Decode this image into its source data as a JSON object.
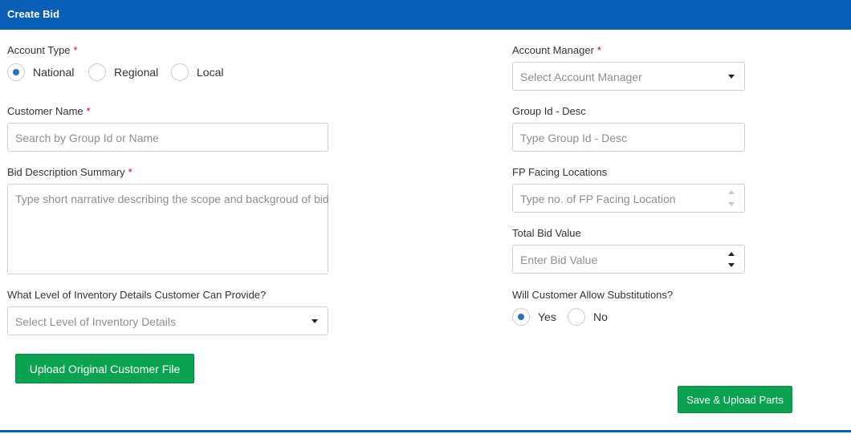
{
  "colors": {
    "brand": "#0a5fb8",
    "accent": "#2d6fc2",
    "button": "#0aa350",
    "required": "#d0021b"
  },
  "header": {
    "title": "Create Bid"
  },
  "account_type": {
    "label": "Account Type",
    "required_mark": "*",
    "options": [
      "National",
      "Regional",
      "Local"
    ],
    "selected": "National"
  },
  "account_manager": {
    "label": "Account Manager",
    "required_mark": "*",
    "placeholder": "Select Account Manager"
  },
  "customer_name": {
    "label": "Customer Name",
    "required_mark": "*",
    "placeholder": "Search by Group Id or Name"
  },
  "group_id": {
    "label": "Group Id - Desc",
    "placeholder": "Type Group Id - Desc"
  },
  "bid_description": {
    "label": "Bid Description Summary",
    "required_mark": "*",
    "placeholder": "Type short narrative describing the scope and backgroud of bid"
  },
  "fp_facing": {
    "label": "FP Facing Locations",
    "placeholder": "Type no. of FP Facing Location"
  },
  "total_bid": {
    "label": "Total Bid Value",
    "placeholder": "Enter Bid Value"
  },
  "inventory_level": {
    "label": "What Level of Inventory Details Customer Can Provide?",
    "placeholder": "Select Level of Inventory Details"
  },
  "substitutions": {
    "label": "Will Customer Allow Substitutions?",
    "options": [
      "Yes",
      "No"
    ],
    "selected": "Yes"
  },
  "buttons": {
    "upload_file": "Upload Original Customer File",
    "save_upload": "Save & Upload Parts"
  }
}
